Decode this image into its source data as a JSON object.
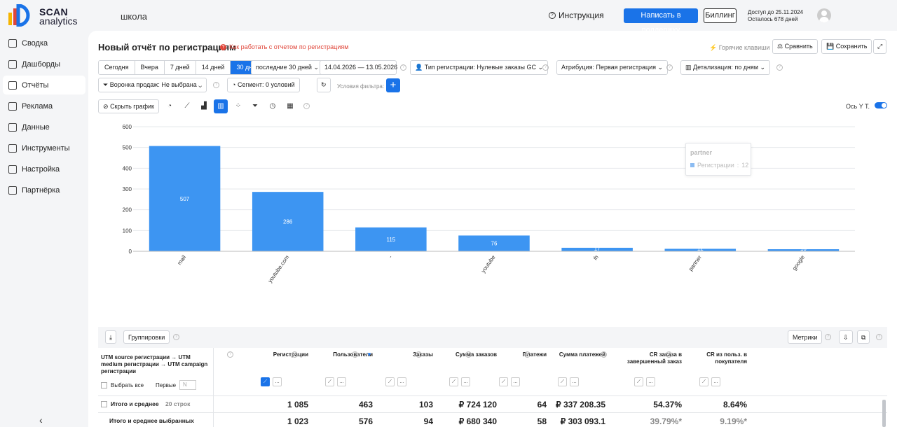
{
  "brand": {
    "line1": "SCAN",
    "line2": "analytics"
  },
  "header": {
    "search": "школа",
    "instruction": "Инструкция",
    "support": "Написать в поддержку",
    "billing": "Биллинг",
    "access_line1": "Доступ до 25.11.2024",
    "access_line2": "Осталось 678 дней"
  },
  "sidebar": {
    "items": [
      {
        "label": "Сводка",
        "icon": "summary-icon"
      },
      {
        "label": "Дашборды",
        "icon": "dashboards-icon"
      },
      {
        "label": "Отчёты",
        "icon": "reports-icon"
      },
      {
        "label": "Реклама",
        "icon": "ads-icon"
      },
      {
        "label": "Данные",
        "icon": "data-icon"
      },
      {
        "label": "Инструменты",
        "icon": "tools-icon"
      },
      {
        "label": "Настройка",
        "icon": "settings-icon"
      },
      {
        "label": "Партнёрка",
        "icon": "partner-icon"
      }
    ],
    "collapse": "‹"
  },
  "report": {
    "title": "Новый отчёт по регистрациям",
    "howto": "Как работать с отчетом по регистрациям",
    "hotkeys": "Горячие клавиши",
    "compare": "Сравнить",
    "save": "Сохранить"
  },
  "filters": {
    "periods": [
      "Сегодня",
      "Вчера",
      "7 дней",
      "14 дней",
      "30 дней"
    ],
    "last": "последние 30 дней",
    "date_from": "14.04.2026",
    "date_to": "13.05.2026",
    "date_sep": "—",
    "reg_type": "Тип регистрации: Нулевые заказы GC",
    "attribution": "Атрибуция: Первая регистрация",
    "detail": "Детализация:  по дням",
    "funnel": "Воронка продаж: Не выбрана",
    "segment": "Сегмент: 0 условий",
    "conditions": "Условия фильтра:"
  },
  "toolbar": {
    "hide_chart": "Скрыть график",
    "axis_y": "Ось Y",
    "axis_y_suffix": "Т."
  },
  "chart_data": {
    "type": "bar",
    "categories": [
      "mail",
      "youtube.com",
      "-",
      "youtube",
      "ih",
      "partner",
      "google"
    ],
    "values": [
      507,
      286,
      115,
      76,
      17,
      12,
      10
    ],
    "ylim": [
      0,
      600
    ],
    "yticks": [
      0,
      100,
      200,
      300,
      400,
      500,
      600
    ],
    "color": "#3d95f2",
    "grid": true
  },
  "tooltip": {
    "title": "partner",
    "series": "Регистрации",
    "value": "12"
  },
  "table": {
    "groupings": "Группировки",
    "metrics": "Метрики",
    "dim_header": "UTM source регистрации → UTM medium регистрации → UTM campaign регистрации",
    "select_all": "Выбрать все",
    "first": "Первые",
    "first_placeholder": "N",
    "columns": [
      "Регистрации",
      "Пользователи",
      "Заказы",
      "Сумма заказов",
      "Платежи",
      "Сумма платежей",
      "CR заказа в завершенный заказ",
      "CR из польз. в покупателя"
    ],
    "total_label": "Итого и среднее",
    "total_rows": "20 строк",
    "total_values": [
      "1 085",
      "463",
      "103",
      "₽ 724 120",
      "64",
      "₽ 337 208.35",
      "54.37%",
      "8.64%"
    ],
    "selected_label": "Итого и среднее выбранных",
    "selected_values": [
      "1 023",
      "576",
      "94",
      "₽ 680 340",
      "58",
      "₽ 303 093.1",
      "39.79%*",
      "9.19%*"
    ]
  }
}
